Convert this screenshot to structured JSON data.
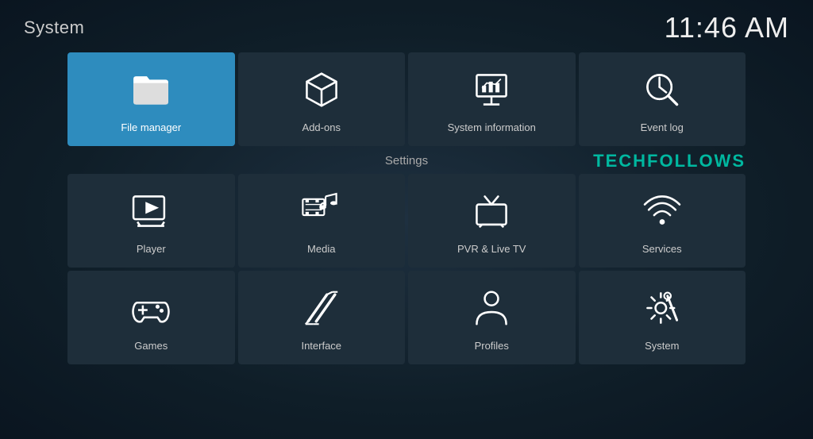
{
  "header": {
    "app_title": "System",
    "clock": "11:46 AM"
  },
  "top_section": {
    "tiles": [
      {
        "id": "file-manager",
        "label": "File manager",
        "active": true
      },
      {
        "id": "add-ons",
        "label": "Add-ons",
        "active": false
      },
      {
        "id": "system-information",
        "label": "System information",
        "active": false
      },
      {
        "id": "event-log",
        "label": "Event log",
        "active": false
      }
    ]
  },
  "settings_section": {
    "title": "Settings",
    "watermark": "TECHFOLLOWS",
    "rows": [
      [
        {
          "id": "player",
          "label": "Player"
        },
        {
          "id": "media",
          "label": "Media"
        },
        {
          "id": "pvr-live-tv",
          "label": "PVR & Live TV"
        },
        {
          "id": "services",
          "label": "Services"
        }
      ],
      [
        {
          "id": "games",
          "label": "Games"
        },
        {
          "id": "interface",
          "label": "Interface"
        },
        {
          "id": "profiles",
          "label": "Profiles"
        },
        {
          "id": "system",
          "label": "System"
        }
      ]
    ]
  }
}
